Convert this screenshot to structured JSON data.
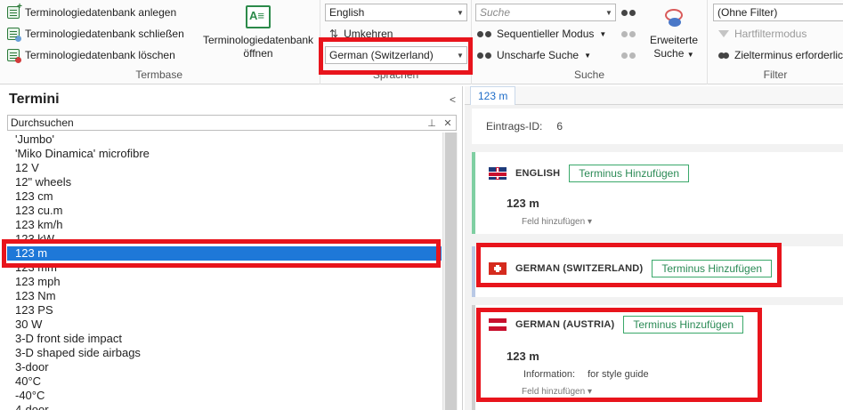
{
  "ribbon": {
    "termbase": {
      "create_label": "Terminologiedatenbank anlegen",
      "close_label": "Terminologiedatenbank schließen",
      "delete_label": "Terminologiedatenbank löschen",
      "open_line1": "Terminologiedatenbank",
      "open_line2": "öffnen",
      "group_label": "Termbase"
    },
    "languages": {
      "source_value": "English",
      "swap_label": "Umkehren",
      "target_value": "German (Switzerland)",
      "group_label": "Sprachen"
    },
    "search": {
      "input_placeholder": "Suche",
      "sequential_label": "Sequentieller Modus",
      "fuzzy_label": "Unscharfe Suche",
      "extended_line1": "Erweiterte",
      "extended_line2": "Suche",
      "group_label": "Suche"
    },
    "filter": {
      "value": "(Ohne Filter)",
      "hard_filter_label": "Hartfiltermodus",
      "target_required_label": "Zielterminus erforderlich",
      "group_label": "Filter"
    }
  },
  "left_panel": {
    "title": "Termini",
    "search_label": "Durchsuchen",
    "terms": [
      "'Jumbo'",
      "'Miko Dinamica' microfibre",
      "12 V",
      "12\" wheels",
      "123 cm",
      "123 cu.m",
      "123 km/h",
      "123 kW",
      "123 m",
      "123 mm",
      "123 mph",
      "123 Nm",
      "123 PS",
      "30 W",
      "3-D front side impact",
      "3-D shaped side airbags",
      "3-door",
      "40°C",
      "-40°C",
      "4-door"
    ],
    "selected_index": 8
  },
  "right_panel": {
    "tab_label": "123 m",
    "entry_id_label": "Eintrags-ID:",
    "entry_id_value": "6",
    "add_term_label": "Terminus Hinzufügen",
    "field_add_label": "Feld hinzufügen ▾",
    "english": {
      "language": "ENGLISH",
      "term": "123 m"
    },
    "swiss": {
      "language": "GERMAN (SWITZERLAND)"
    },
    "austria": {
      "language": "GERMAN (AUSTRIA)",
      "term": "123 m",
      "info_label": "Information:",
      "info_value": "for style guide"
    }
  },
  "colors": {
    "selection": "#1e78d8",
    "highlight_frame": "#e8141c",
    "add_term_border": "#3aa86a"
  }
}
